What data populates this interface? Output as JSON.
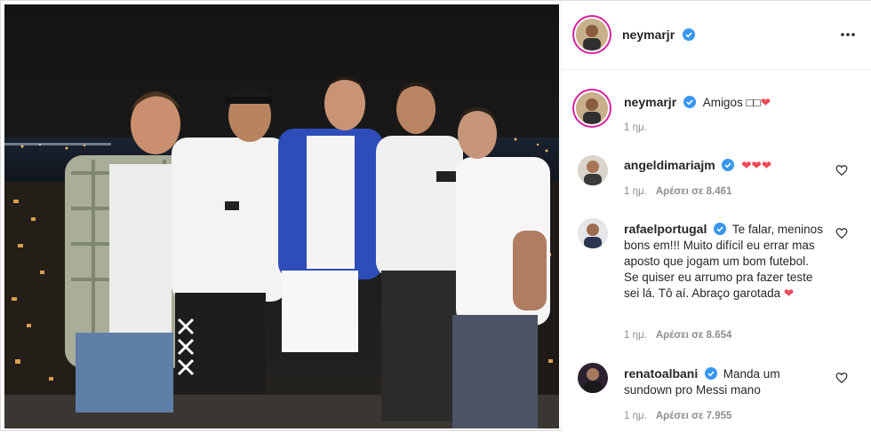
{
  "post": {
    "author": "neymarjr",
    "author_verified": true,
    "more_icon": "more-options-icon"
  },
  "caption": {
    "username": "neymarjr",
    "text": "Amigos □□",
    "heart": "❤",
    "time": "1 ημ."
  },
  "comments": [
    {
      "username": "angeldimariajm",
      "text": "",
      "hearts": "❤❤❤",
      "time": "1 ημ.",
      "likes": "Αρέσει σε 8.461"
    },
    {
      "username": "rafaelportugal",
      "text": "Te falar, meninos bons em!!! Muito difícil eu errar mas aposto que jogam um bom futebol. Se quiser eu arrumo pra fazer teste sei lá. Tô aí. Abraço garotada",
      "hearts": "❤",
      "time": "1 ημ.",
      "likes": "Αρέσει σε 8.654"
    },
    {
      "username": "renatoalbani",
      "text": "Manda um sundown pro Messi mano",
      "hearts": "",
      "time": "1 ημ.",
      "likes": "Αρέσει σε 7.955"
    }
  ],
  "colors": {
    "verified": "#3897f0",
    "heart": "#ed4956",
    "muted": "#8e8e8e",
    "story_ring": "#d6249f"
  }
}
